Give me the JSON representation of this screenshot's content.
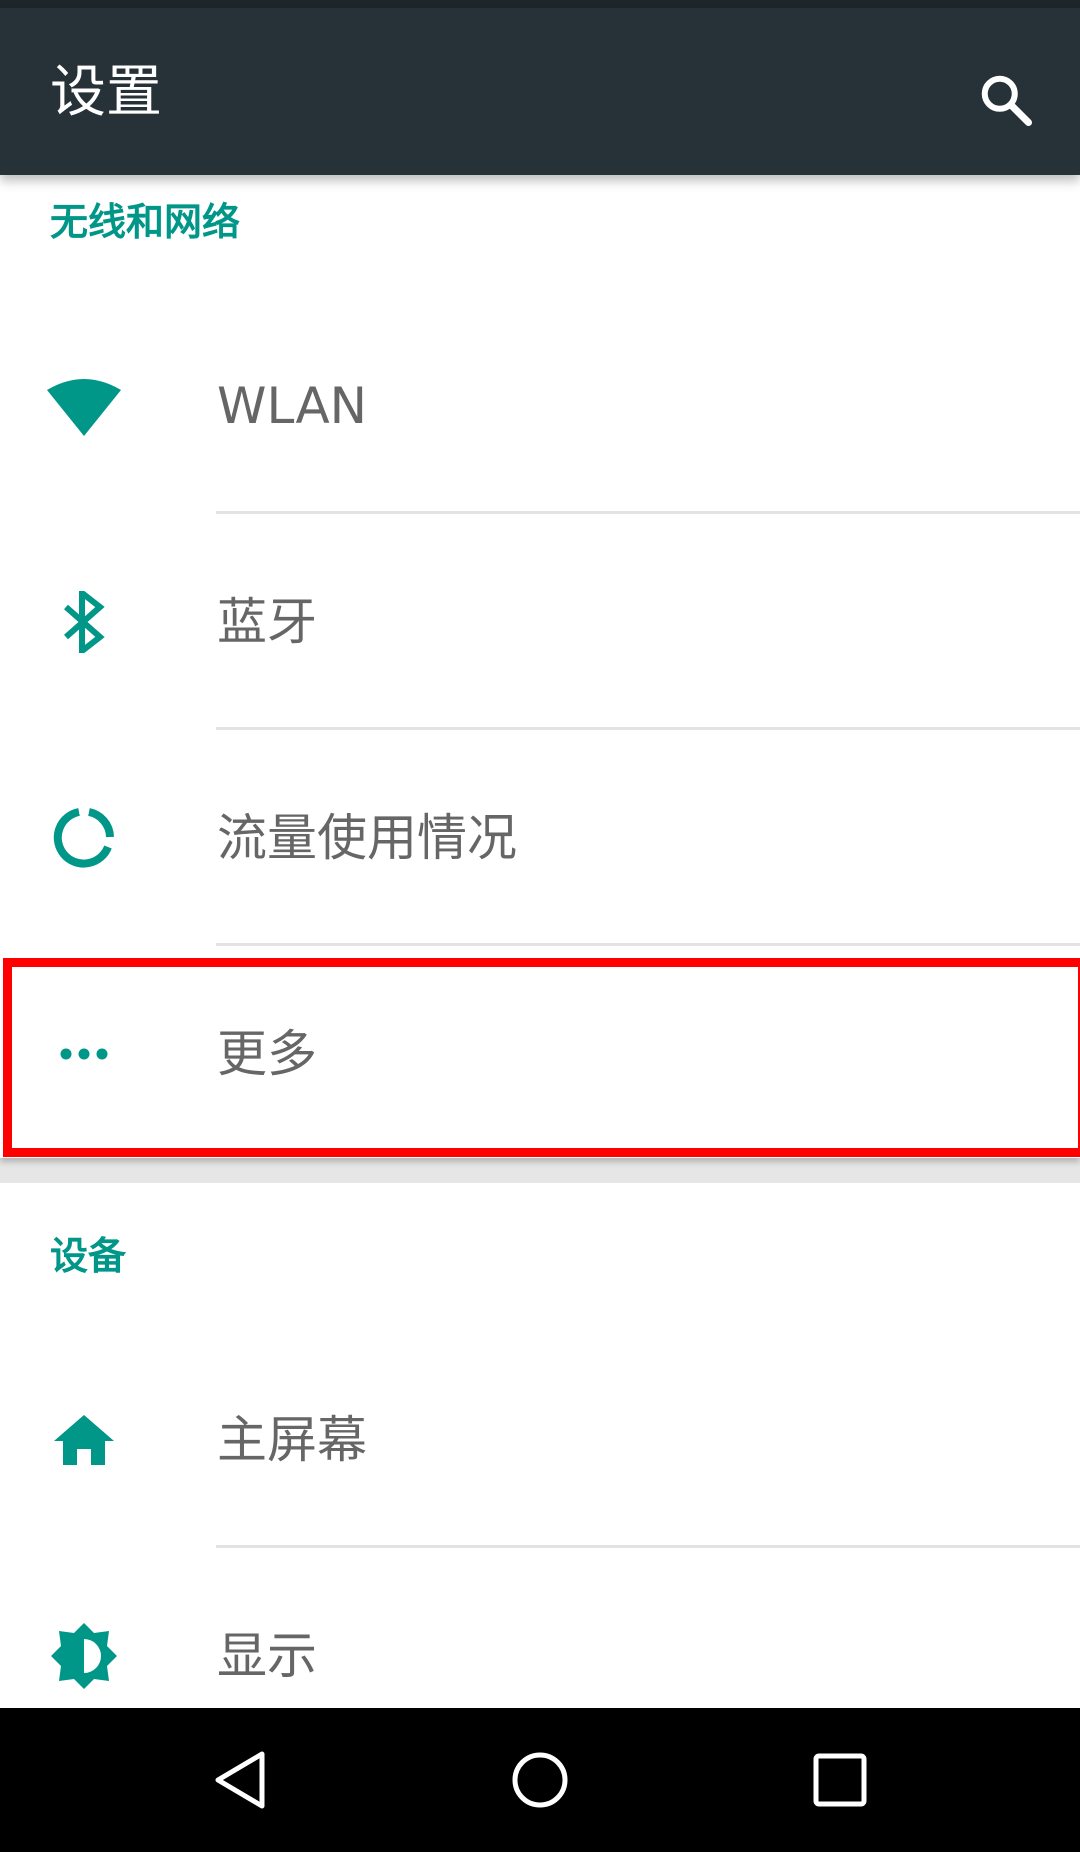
{
  "app_bar": {
    "title": "设置",
    "search_icon": "search-icon",
    "background": "#263238"
  },
  "accent_color": "#009688",
  "sections": [
    {
      "header": "无线和网络",
      "items": [
        {
          "label": "WLAN",
          "icon": "wifi-icon"
        },
        {
          "label": "蓝牙",
          "icon": "bluetooth-icon"
        },
        {
          "label": "流量使用情况",
          "icon": "data-usage-icon"
        },
        {
          "label": "更多",
          "icon": "more-horiz-icon"
        }
      ]
    },
    {
      "header": "设备",
      "items": [
        {
          "label": "主屏幕",
          "icon": "home-icon"
        },
        {
          "label": "显示",
          "icon": "brightness-icon"
        }
      ]
    }
  ],
  "highlighted_item": "更多",
  "highlight_color": "#ff0000",
  "nav_bar": {
    "buttons": [
      "back-icon",
      "home-circle-icon",
      "recents-icon"
    ]
  }
}
